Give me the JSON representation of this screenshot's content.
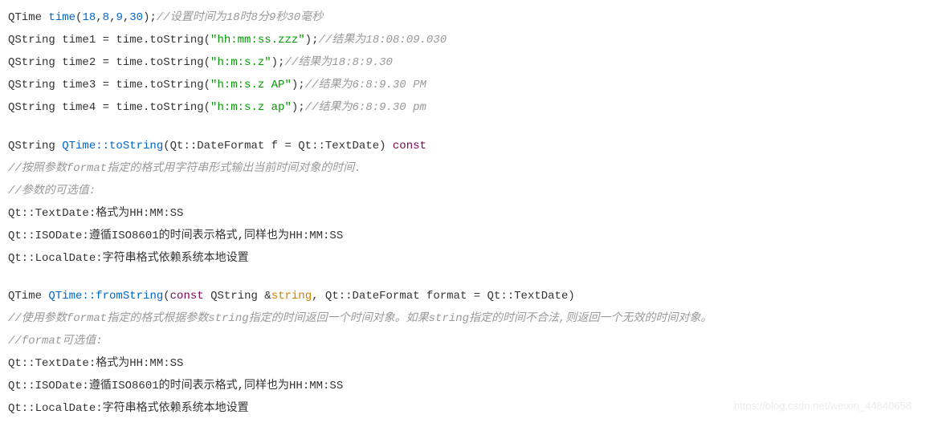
{
  "lines": {
    "l1": {
      "pre": "QTime ",
      "fn": "time",
      "args_open": "(",
      "n1": "18",
      "c1": ",",
      "n2": "8",
      "c2": ",",
      "n3": "9",
      "c3": ",",
      "n4": "30",
      "args_close": ");",
      "comment": "//设置时间为18时8分9秒30毫秒"
    },
    "l2": {
      "pre": "QString time1 = time.toString(",
      "str": "\"hh:mm:ss.zzz\"",
      "post": ");",
      "comment": "//结果为18:08:09.030"
    },
    "l3": {
      "pre": "QString time2 = time.toString(",
      "str": "\"h:m:s.z\"",
      "post": ");",
      "comment": "//结果为18:8:9.30"
    },
    "l4": {
      "pre": "QString time3 = time.toString(",
      "str": "\"h:m:s.z AP\"",
      "post": ");",
      "comment": "//结果为6:8:9.30 PM"
    },
    "l5": {
      "pre": "QString time4 = time.toString(",
      "str": "\"h:m:s.z ap\"",
      "post": ");",
      "comment": "//结果为6:8:9.30 pm"
    },
    "l6": {
      "pre": "QString ",
      "fn": "QTime::toString",
      "sig": "(Qt::DateFormat f = Qt::TextDate) ",
      "kw": "const"
    },
    "l7": {
      "comment": "//按照参数format指定的格式用字符串形式输出当前时间对象的时间."
    },
    "l8": {
      "comment": "//参数的可选值:"
    },
    "l9": {
      "text": "Qt::TextDate:格式为HH:MM:SS"
    },
    "l10": {
      "text": "Qt::ISODate:遵循ISO8601的时间表示格式,同样也为HH:MM:SS"
    },
    "l11": {
      "text": "Qt::LocalDate:字符串格式依赖系统本地设置"
    },
    "l12": {
      "pre": "QTime ",
      "fn": "QTime::fromString",
      "open": "(",
      "kw": "const",
      "mid": " QString &",
      "param": "string",
      "rest": ", Qt::DateFormat format = Qt::TextDate)"
    },
    "l13": {
      "comment": "//使用参数format指定的格式根据参数string指定的时间返回一个时间对象。如果string指定的时间不合法,则返回一个无效的时间对象。"
    },
    "l14": {
      "comment": "//format可选值:"
    },
    "l15": {
      "text": "Qt::TextDate:格式为HH:MM:SS"
    },
    "l16": {
      "text": "Qt::ISODate:遵循ISO8601的时间表示格式,同样也为HH:MM:SS"
    },
    "l17": {
      "text": "Qt::LocalDate:字符串格式依赖系统本地设置"
    }
  },
  "watermark": "https://blog.csdn.net/weixin_44840658"
}
